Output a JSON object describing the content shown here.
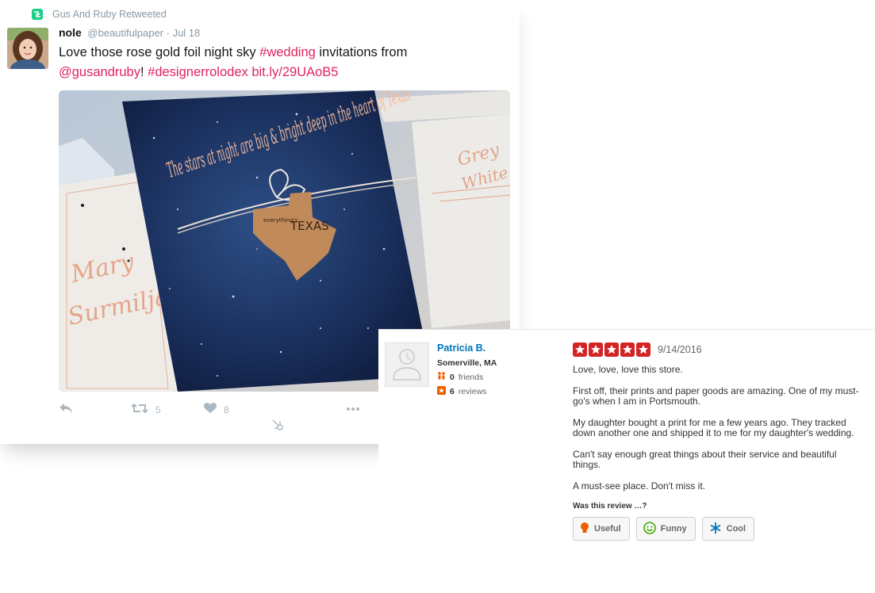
{
  "tweet": {
    "retweet_label": "Gus And Ruby Retweeted",
    "author_name": "nole",
    "author_handle": "@beautifulpaper",
    "date": "· Jul 18",
    "text": {
      "part1": "Love those rose gold foil night sky ",
      "hashtag1": "#wedding",
      "part2": " invitations from ",
      "mention": "@gusandruby",
      "part3": "! ",
      "hashtag2": "#designerrolodex",
      "space": " ",
      "link": "bit.ly/29UAoB5"
    },
    "image": {
      "card_text": "The stars at night are big & bright deep in the heart of Texas",
      "tag_small": "everything's",
      "tag_text": "TEXAS",
      "left_script1": "Mary",
      "left_script2": "Surmiljan",
      "right_script1": "Grey",
      "right_script2": "White"
    },
    "retweets": "5",
    "likes": "8",
    "colors": {
      "link": "#e0245e",
      "muted": "#aab8c2",
      "retweet_badge": "#19cf86"
    }
  },
  "review": {
    "reviewer_name": "Patricia B.",
    "location": "Somerville, MA",
    "friends": "0",
    "friends_label": "friends",
    "reviews": "6",
    "reviews_label": "reviews",
    "rating": 5,
    "date": "9/14/2016",
    "paragraphs": [
      "Love, love, love this store.",
      "First off, their prints and paper goods are amazing. One of my must-go's when I am in Portsmouth.",
      "My daughter bought a print for me a few years ago. They tracked down another one and shipped it to me for my daughter's wedding.",
      "Can't say enough great things about their service and beautiful things.",
      "A must-see place. Don't miss it."
    ],
    "vote_prompt": "Was this review …?",
    "buttons": {
      "useful": "Useful",
      "funny": "Funny",
      "cool": "Cool"
    },
    "colors": {
      "name": "#0073bb",
      "star": "#d32323"
    }
  }
}
